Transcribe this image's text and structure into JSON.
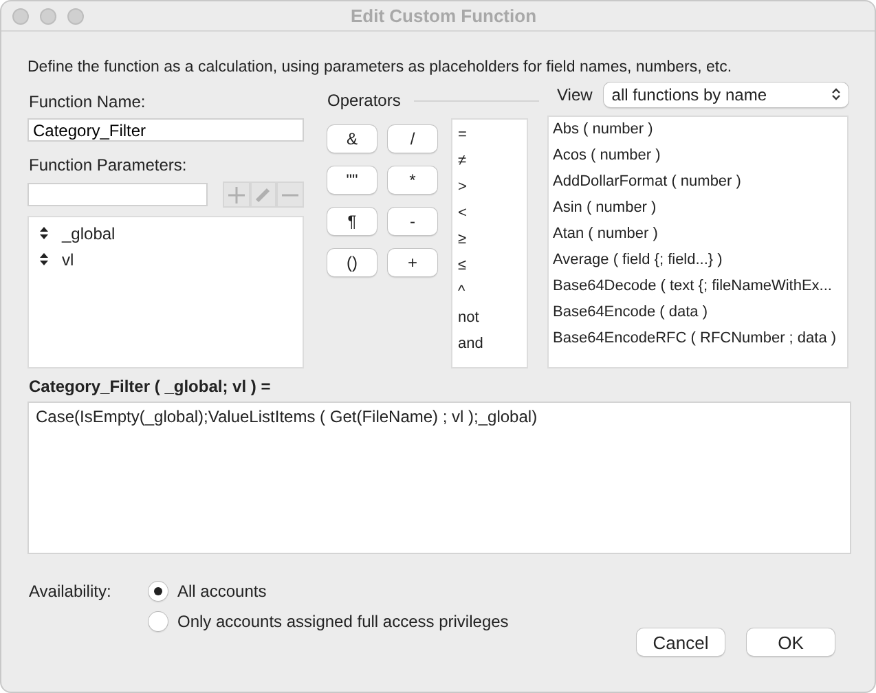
{
  "window": {
    "title": "Edit Custom Function"
  },
  "description": "Define the function as a calculation, using parameters as placeholders for field names, numbers, etc.",
  "function_name": {
    "label": "Function Name:",
    "value": "Category_Filter"
  },
  "parameters": {
    "label": "Function Parameters:",
    "items": [
      {
        "name": "_global"
      },
      {
        "name": "vl"
      }
    ]
  },
  "operators": {
    "label": "Operators",
    "buttons": [
      "&",
      "/",
      "\"\"",
      "*",
      "¶",
      "-",
      "()",
      "+"
    ],
    "list": [
      "=",
      "≠",
      ">",
      "<",
      "≥",
      "≤",
      "^",
      "not",
      "and"
    ]
  },
  "view": {
    "label": "View",
    "value": "all functions by name"
  },
  "functions": [
    "Abs ( number )",
    "Acos ( number )",
    "AddDollarFormat ( number )",
    "Asin ( number )",
    "Atan ( number )",
    "Average ( field {; field...} )",
    "Base64Decode ( text {; fileNameWithEx...",
    "Base64Encode ( data )",
    "Base64EncodeRFC ( RFCNumber ; data )"
  ],
  "formula": {
    "label": "Category_Filter ( _global; vl ) =",
    "value": "Case(IsEmpty(_global);ValueListItems ( Get(FileName) ; vl );_global)"
  },
  "availability": {
    "label": "Availability:",
    "options": [
      {
        "label": "All accounts",
        "selected": true
      },
      {
        "label": "Only accounts assigned full access privileges",
        "selected": false
      }
    ]
  },
  "buttons": [
    "Cancel",
    "OK"
  ]
}
